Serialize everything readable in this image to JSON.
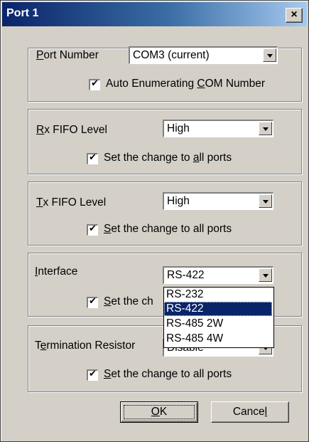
{
  "window": {
    "title": "Port 1",
    "close_glyph": "×"
  },
  "port_number": {
    "label_u": "P",
    "label_rest": "ort Number",
    "value": "COM3 (current)",
    "auto_check": {
      "pre": "Auto Enumerating ",
      "u": "C",
      "rest": "OM Number",
      "checked": true
    }
  },
  "rx_fifo": {
    "label_u": "R",
    "label_rest": "x FIFO Level",
    "value": "High",
    "check": {
      "pre": "Set the change to ",
      "u": "a",
      "rest": "ll ports",
      "checked": true
    }
  },
  "tx_fifo": {
    "label_u": "T",
    "label_rest": "x FIFO Level",
    "value": "High",
    "check": {
      "pre": "",
      "u": "S",
      "rest": "et the change to all ports",
      "checked": true
    }
  },
  "interface": {
    "label_u": "I",
    "label_rest": "nterface",
    "value": "RS-422",
    "check": {
      "u": "S",
      "rest": "et the ch",
      "checked": true
    },
    "options": [
      "RS-232",
      "RS-422",
      "RS-485 2W",
      "RS-485 4W"
    ],
    "selected_index": 1
  },
  "termination": {
    "label_pre": "T",
    "label_u": "e",
    "label_rest": "rmination Resistor",
    "value": "Disable",
    "check": {
      "u": "S",
      "rest": "et the change to all ports",
      "checked": true
    }
  },
  "buttons": {
    "ok": {
      "u": "O",
      "rest": "K"
    },
    "cancel": {
      "pre": "Cance",
      "u": "l"
    }
  },
  "icons": {
    "checkbox": "check-icon",
    "dropdown": "chevron-down-icon",
    "close": "close-icon"
  },
  "colors": {
    "titlebar_start": "#0a246a",
    "face": "#d4d0c8",
    "highlight": "#0a246a"
  }
}
